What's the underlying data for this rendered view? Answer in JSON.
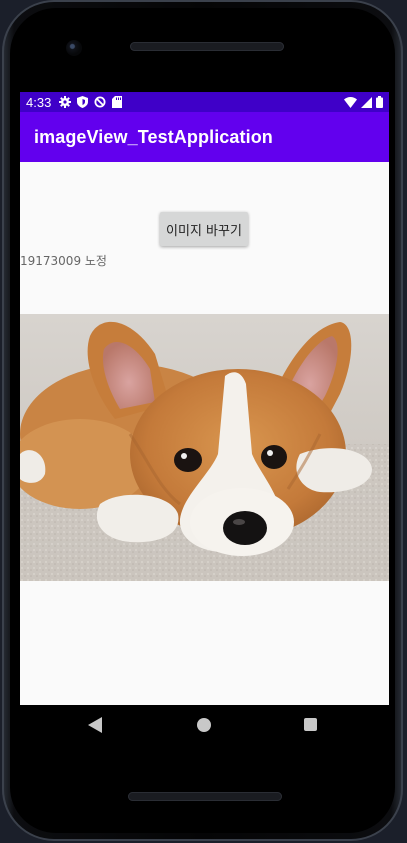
{
  "status_bar": {
    "time": "4:33",
    "left_icons": [
      "gear-icon",
      "shield-icon",
      "sync-icon",
      "sd-card-icon"
    ],
    "right_icons": [
      "wifi-icon",
      "signal-icon",
      "battery-icon"
    ],
    "background": "#3f00c8"
  },
  "app_bar": {
    "title": "imageView_TestApplication",
    "background": "#6200ee"
  },
  "content": {
    "change_image_button": "이미지 바꾸기",
    "student_label": "19173009 노정",
    "image": "corgi-puppy-photo"
  },
  "nav_bar": {
    "icons": [
      "back-icon",
      "home-icon",
      "recents-icon"
    ]
  }
}
